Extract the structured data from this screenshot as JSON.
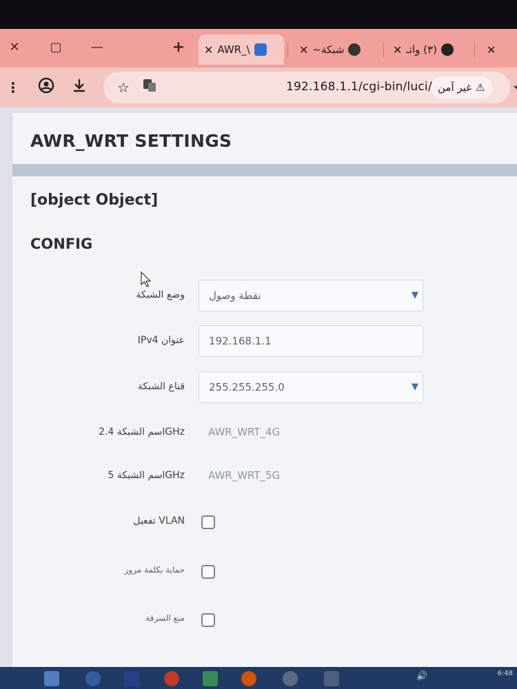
{
  "browser": {
    "tabs": [
      {
        "label": "AWR_\\",
        "active": true
      },
      {
        "label": "شبكة~",
        "active": false
      },
      {
        "label": "(٣) واتـ",
        "active": false
      }
    ],
    "new_tab_glyph": "+",
    "close_glyph": "✕",
    "url": "192.168.1.1/cgi-bin/luci/",
    "security_label": "غير آمن",
    "icons": [
      "menu-dots-icon",
      "profile-icon",
      "download-icon",
      "star-icon",
      "translate-icon",
      "warning-icon",
      "extensions-icon"
    ]
  },
  "page": {
    "title": "AWR_WRT SETTINGS",
    "section_title": "[object Object]",
    "config_heading": "CONFIG",
    "fields": [
      {
        "label": "وضع الشبكة",
        "value": "نقطة وصول",
        "type": "select"
      },
      {
        "label": "IPv4 عنوان",
        "value": "192.168.1.1",
        "type": "text"
      },
      {
        "label": "قناع الشبكة",
        "value": "255.255.255.0",
        "type": "select"
      },
      {
        "label": "اسم الشبكة 2.4GHz",
        "value": "AWR_WRT_4G",
        "type": "text"
      },
      {
        "label": "اسم الشبكة 5GHz",
        "value": "AWR_WRT_5G",
        "type": "text"
      },
      {
        "label": "تفعيل VLAN",
        "checked": false,
        "type": "checkbox"
      },
      {
        "label": "حماية بكلمة مرور",
        "checked": false,
        "type": "checkbox"
      },
      {
        "label": "منع السرقة",
        "checked": false,
        "type": "checkbox"
      }
    ]
  },
  "taskbar": {
    "clock": "6:48"
  },
  "colors": {
    "tabstrip": "#f2a09a",
    "toolbar": "#f3c6c2",
    "page_bg": "#dfe3e9",
    "accent": "#3b6fb6"
  }
}
